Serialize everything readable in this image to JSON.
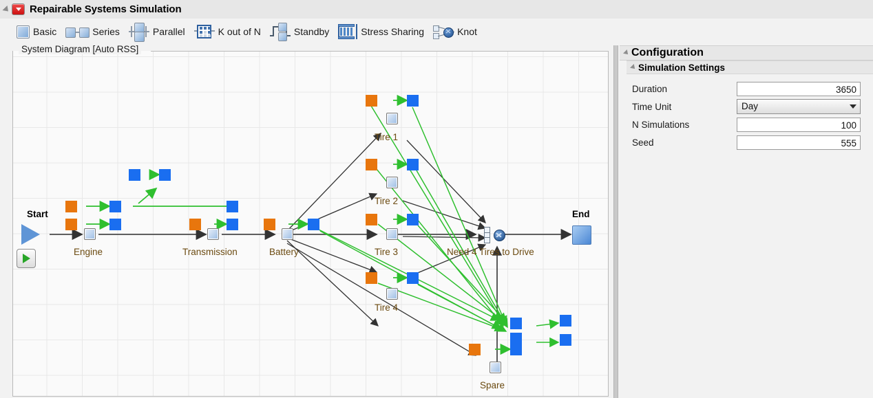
{
  "window": {
    "title": "Repairable Systems Simulation",
    "disclosure_icon": "triangle-disclosure-icon",
    "menu_icon": "red-dropdown-icon"
  },
  "toolbar": {
    "items": [
      {
        "label": "Basic",
        "icon": "basic-block-icon"
      },
      {
        "label": "Series",
        "icon": "series-block-icon"
      },
      {
        "label": "Parallel",
        "icon": "parallel-block-icon"
      },
      {
        "label": "K out of N",
        "icon": "k-out-of-n-block-icon"
      },
      {
        "label": "Standby",
        "icon": "standby-block-icon"
      },
      {
        "label": "Stress Sharing",
        "icon": "stress-sharing-block-icon"
      },
      {
        "label": "Knot",
        "icon": "knot-block-icon"
      }
    ]
  },
  "diagram": {
    "group_title": "System Diagram [Auto RSS]",
    "start_label": "Start",
    "end_label": "End",
    "run_icon": "run-play-icon",
    "start_icon": "start-triangle-icon",
    "end_icon": "end-block-icon",
    "knot_icon": "knot-node-icon",
    "component_labels": [
      "Engine",
      "Transmission",
      "Battery",
      "Tire 1",
      "Tire 2",
      "Tire 3",
      "Tire 4",
      "Need 4 Tires to Drive",
      "Spare"
    ],
    "colors": {
      "failure_node": "#e8760d",
      "repair_node": "#1a6ef0",
      "component_node": "#9cbde4",
      "repair_link": "#2fbf2f",
      "flow_link": "#4a4a4a",
      "end_block": "#4b87d4"
    }
  },
  "configuration": {
    "title": "Configuration",
    "section_title": "Simulation Settings",
    "fields": [
      {
        "label": "Duration",
        "value": "3650",
        "type": "text"
      },
      {
        "label": "Time Unit",
        "value": "Day",
        "type": "combo"
      },
      {
        "label": "N Simulations",
        "value": "100",
        "type": "text"
      },
      {
        "label": "Seed",
        "value": "555",
        "type": "text"
      }
    ]
  }
}
